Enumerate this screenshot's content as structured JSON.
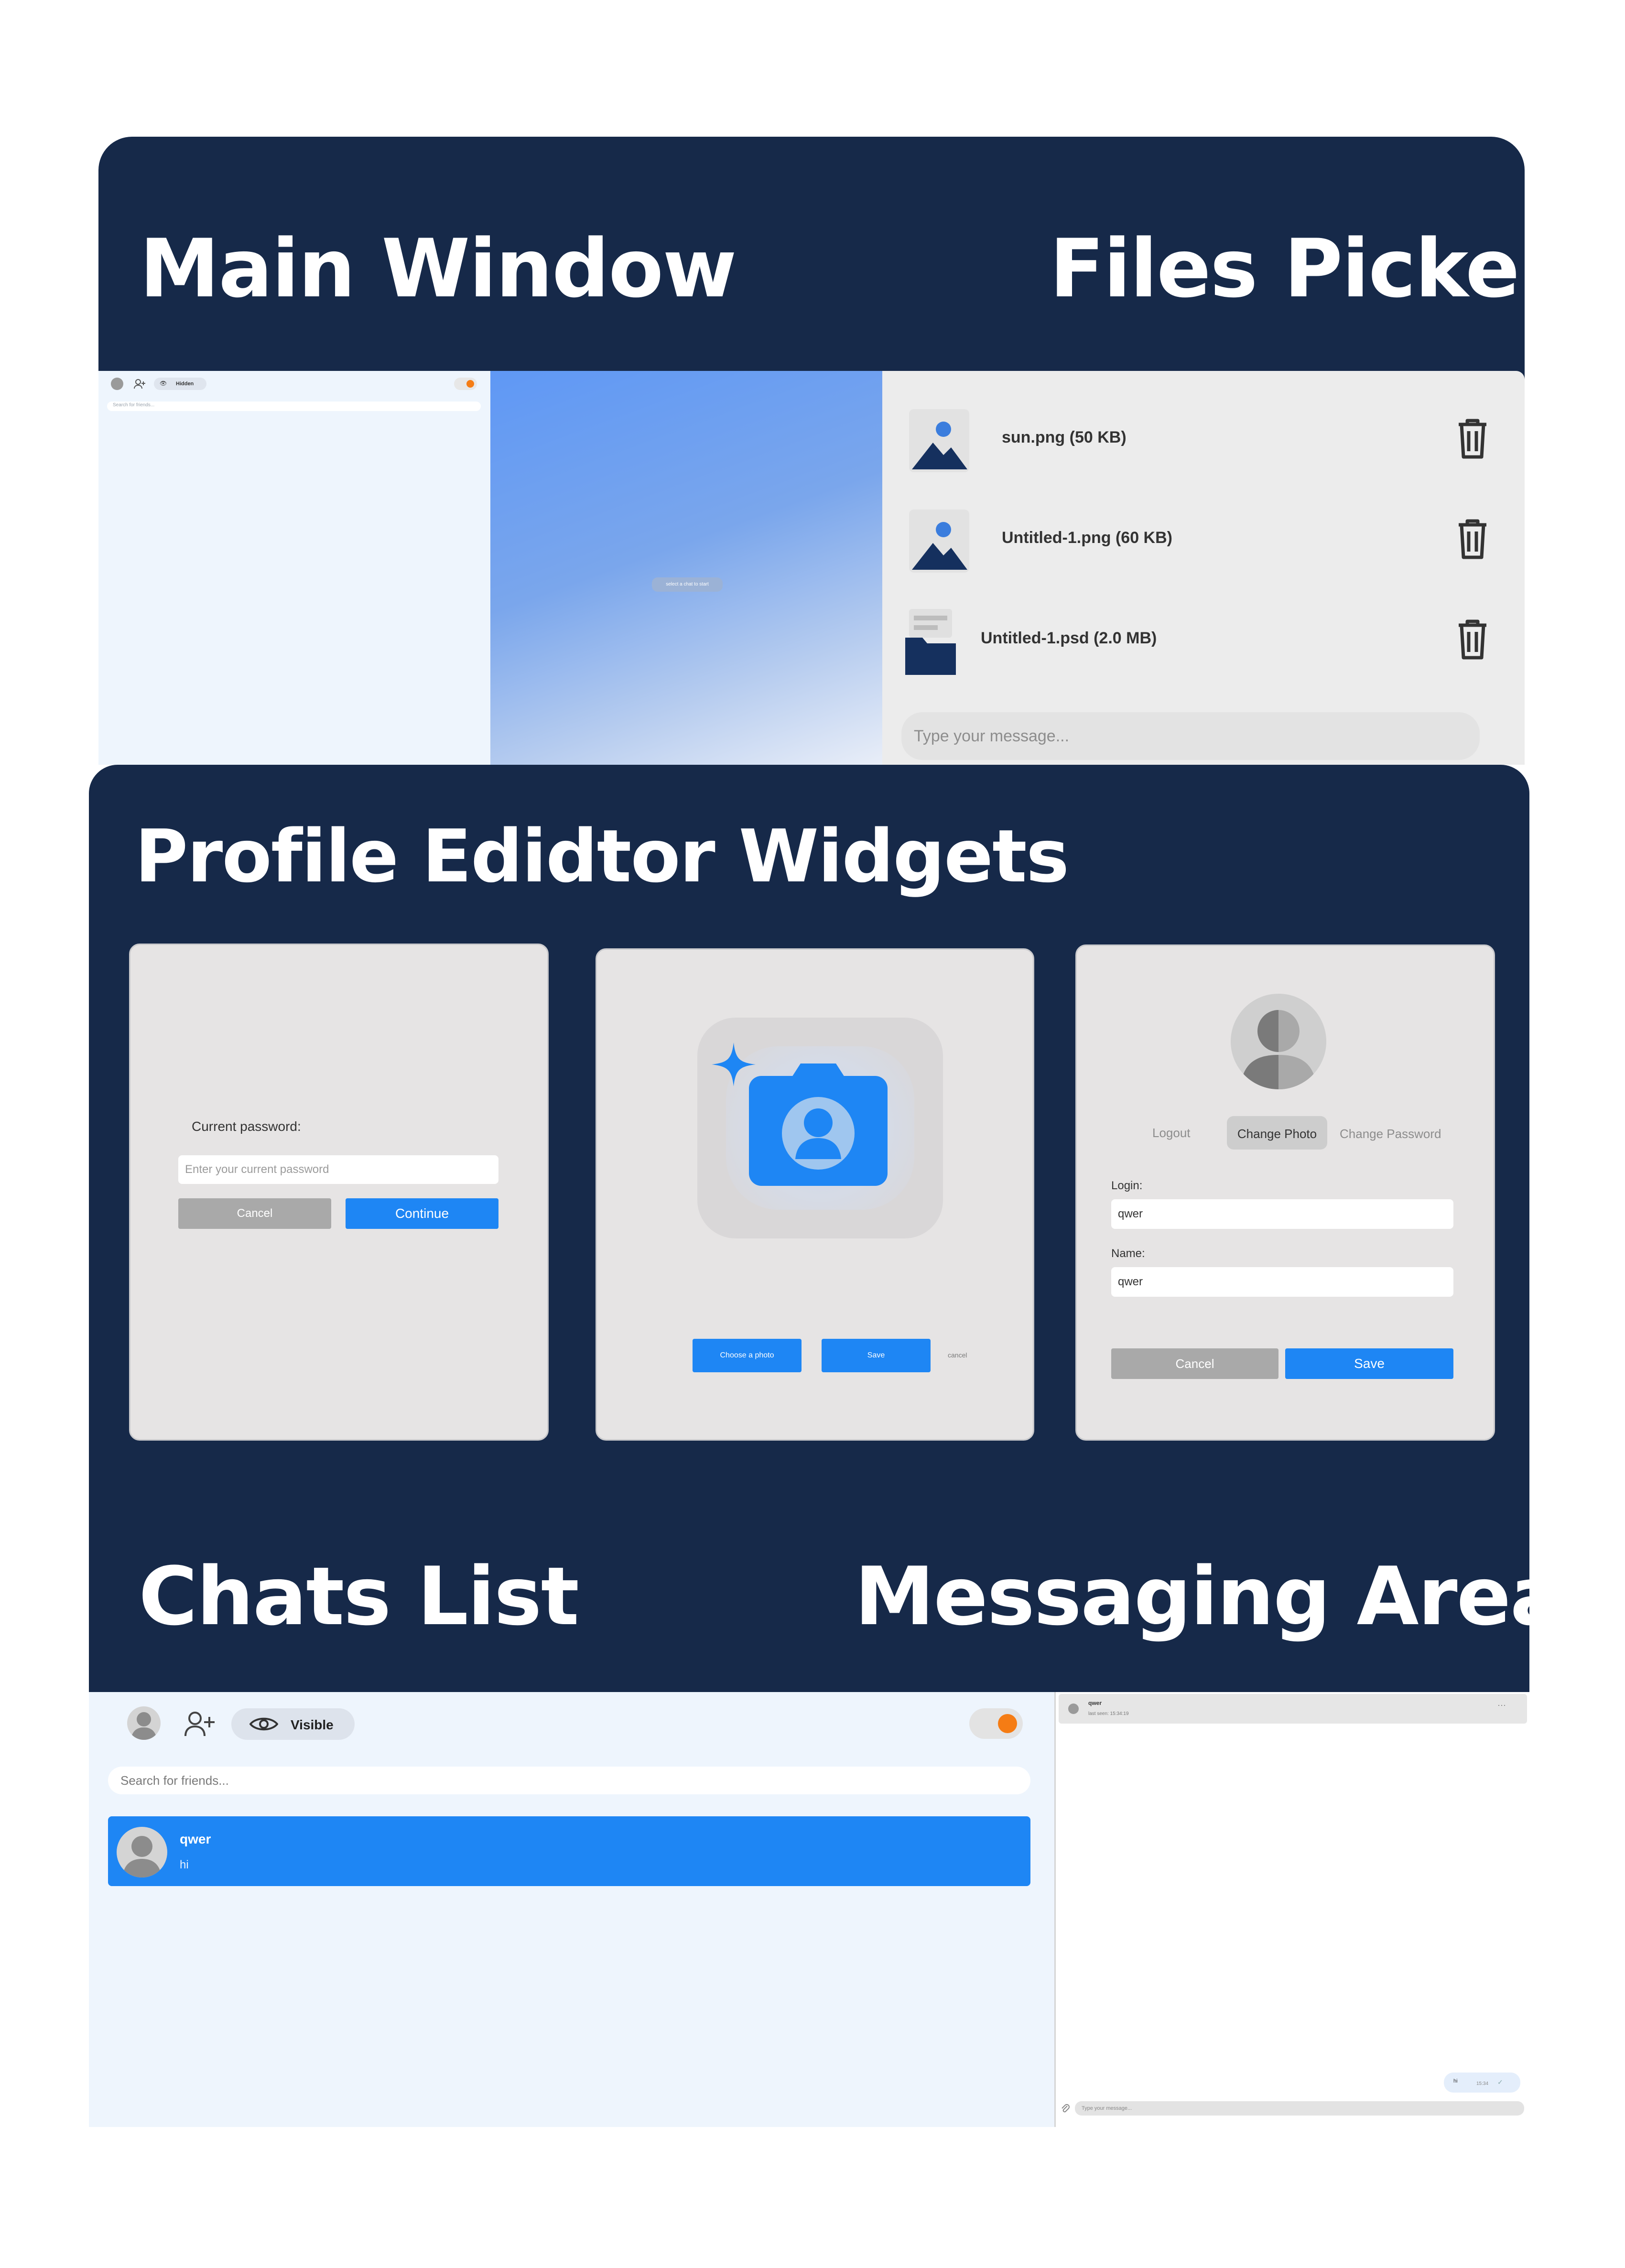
{
  "headings": {
    "main_window": "Main Window",
    "files_picker": "Files Picker",
    "profile_widgets": "Profile Edidtor Widgets",
    "chats_list": "Chats List",
    "messaging_area": "Messaging Area"
  },
  "main_window": {
    "status_label": "Hidden",
    "search_placeholder": "Search for friends...",
    "center_hint": "select a chat to start"
  },
  "files_picker": {
    "files": [
      {
        "name": "sun.png (50 KB)",
        "icon": "image-file-icon"
      },
      {
        "name": "Untitled-1.png (60 KB)",
        "icon": "image-file-icon"
      },
      {
        "name": "Untitled-1.psd (2.0 MB)",
        "icon": "folder-file-icon"
      }
    ],
    "message_placeholder": "Type your message..."
  },
  "password_widget": {
    "label": "Current password:",
    "placeholder": "Enter your current password",
    "cancel": "Cancel",
    "continue": "Continue"
  },
  "photo_widget": {
    "choose": "Choose a photo",
    "save": "Save",
    "cancel": "cancel"
  },
  "profile_widget": {
    "tabs": [
      "Logout",
      "Change Photo",
      "Change Password"
    ],
    "active_tab": "Change Photo",
    "login_label": "Login:",
    "login_value": "qwer",
    "name_label": "Name:",
    "name_value": "qwer",
    "cancel": "Cancel",
    "save": "Save"
  },
  "chats_list": {
    "status_label": "Visible",
    "search_placeholder": "Search for friends...",
    "chats": [
      {
        "name": "qwer",
        "last_message": "hi"
      }
    ]
  },
  "messaging_area": {
    "contact_name": "qwer",
    "last_seen": "last seen: 15:34:19",
    "message_text": "hi",
    "message_time": "15:34",
    "input_placeholder": "Type your message..."
  },
  "colors": {
    "navy": "#162949",
    "accent_blue": "#1e86f4",
    "toggle_orange": "#f57c14"
  }
}
